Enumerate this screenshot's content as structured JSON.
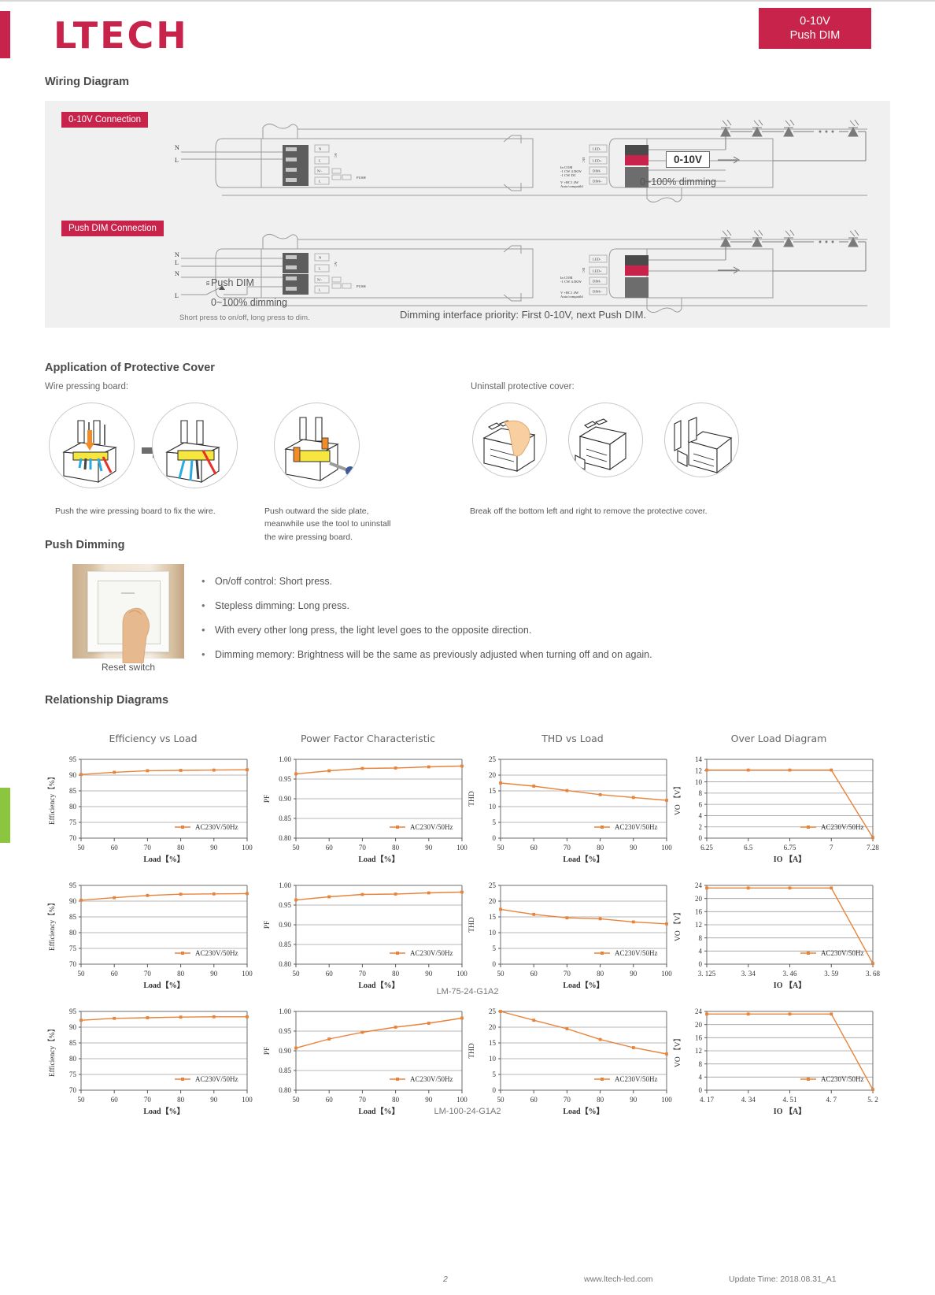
{
  "header": {
    "logo": "LTECH",
    "badge_line1": "0-10V",
    "badge_line2": "Push DIM",
    "brand_color": "#c8234a"
  },
  "sections": {
    "wiring": "Wiring Diagram",
    "cover": "Application of Protective Cover",
    "push": "Push Dimming",
    "relationship": "Relationship Diagrams"
  },
  "wiring": {
    "tag1": "0-10V Connection",
    "tag2": "Push DIM Connection",
    "n_label": "N",
    "l_label": "L",
    "push_dim_label": "Push DIM",
    "dimming_range_1": "0~100% dimming",
    "dimming_range_2": "0~100% dimming",
    "zero_ten_box": "0-10V",
    "short_press_note": "Short press to on/off, long press to dim.",
    "priority_note": "Dimming interface priority: First 0-10V, next Push DIM.",
    "terminal_labels": [
      "N",
      "L",
      "N",
      "L"
    ],
    "out_labels": [
      "LED-",
      "LED+",
      "DIM-",
      "DIM+"
    ],
    "side_ac": "AC",
    "side_dc": "DC"
  },
  "cover": {
    "sub_left": "Wire pressing board:",
    "sub_right": "Uninstall protective cover:",
    "cap1": "Push the wire pressing board to fix the wire.",
    "cap2": "Push outward the side plate,\nmeanwhile use the tool to uninstall\nthe wire pressing board.",
    "cap3": "Break off the bottom left and right to remove the protective cover."
  },
  "push_dimming": {
    "image_caption": "Reset switch",
    "bullets": [
      "On/off control: Short press.",
      "Stepless dimming: Long press.",
      "With every other long press, the light level goes to the opposite direction.",
      "Dimming memory: Brightness will be the same as previously adjusted when turning off and on again."
    ]
  },
  "models": {
    "row2": "LM-75-24-G1A2",
    "row3": "LM-100-24-G1A2"
  },
  "footer": {
    "page_number": "2",
    "website": "www.ltech-led.com",
    "update": "Update Time: 2018.08.31_A1"
  },
  "chart_data": [
    {
      "type": "line",
      "row": 1,
      "col": 1,
      "title": "Efficiency vs Load",
      "xlabel": "Load【%】",
      "ylabel": "Efficiency【%】",
      "legend": "AC230V/50Hz",
      "legend_position": "bottom-right",
      "grid": true,
      "color": "#e8833a",
      "xlim": [
        50,
        100
      ],
      "ylim": [
        70,
        95
      ],
      "xticks": [
        50,
        60,
        70,
        80,
        90,
        100
      ],
      "yticks": [
        70,
        75,
        80,
        85,
        90,
        95
      ],
      "x": [
        50,
        60,
        70,
        80,
        90,
        100
      ],
      "values": [
        90.2,
        90.9,
        91.4,
        91.5,
        91.6,
        91.7
      ]
    },
    {
      "type": "line",
      "row": 1,
      "col": 2,
      "title": "Power Factor Characteristic",
      "xlabel": "Load【%】",
      "ylabel": "PF",
      "legend": "AC230V/50Hz",
      "legend_position": "bottom-right",
      "grid": true,
      "color": "#e8833a",
      "xlim": [
        50,
        100
      ],
      "ylim": [
        0.8,
        1.0
      ],
      "xticks": [
        50,
        60,
        70,
        80,
        90,
        100
      ],
      "yticks": [
        "0.80",
        "0.85",
        "0.90",
        "0.95",
        "1.00"
      ],
      "x": [
        50,
        60,
        70,
        80,
        90,
        100
      ],
      "values": [
        0.963,
        0.971,
        0.977,
        0.978,
        0.981,
        0.983
      ]
    },
    {
      "type": "line",
      "row": 1,
      "col": 3,
      "title": "THD vs Load",
      "xlabel": "Load【%】",
      "ylabel": "THD",
      "legend": "AC230V/50Hz",
      "legend_position": "bottom-right",
      "grid": true,
      "color": "#e8833a",
      "xlim": [
        50,
        100
      ],
      "ylim": [
        0,
        25
      ],
      "xticks": [
        50,
        60,
        70,
        80,
        90,
        100
      ],
      "yticks": [
        0,
        5,
        10,
        15,
        20,
        25
      ],
      "x": [
        50,
        60,
        70,
        80,
        90,
        100
      ],
      "values": [
        17.5,
        16.5,
        15.1,
        13.8,
        12.9,
        12.0
      ]
    },
    {
      "type": "line",
      "row": 1,
      "col": 4,
      "title": "Over Load Diagram",
      "xlabel": "IO 【A】",
      "ylabel": "VO 【V】",
      "legend": "AC230V/50Hz",
      "legend_position": "bottom-right",
      "grid": true,
      "color": "#e8833a",
      "xlim": [
        6.25,
        7.28
      ],
      "ylim": [
        0,
        14
      ],
      "xticks": [
        "6.25",
        "6.5",
        "6.75",
        "7",
        "7.28"
      ],
      "yticks": [
        0,
        2,
        4,
        6,
        8,
        10,
        12,
        14
      ],
      "x": [
        "6.25",
        "6.5",
        "6.75",
        "7",
        "7.28"
      ],
      "values": [
        12.1,
        12.1,
        12.1,
        12.1,
        0.1
      ]
    },
    {
      "type": "line",
      "row": 2,
      "col": 1,
      "title": "",
      "xlabel": "Load【%】",
      "ylabel": "Efficiency【%】",
      "legend": "AC230V/50Hz",
      "legend_position": "bottom-right",
      "grid": true,
      "color": "#e8833a",
      "xlim": [
        50,
        100
      ],
      "ylim": [
        70,
        95
      ],
      "xticks": [
        50,
        60,
        70,
        80,
        90,
        100
      ],
      "yticks": [
        70,
        75,
        80,
        85,
        90,
        95
      ],
      "x": [
        50,
        60,
        70,
        80,
        90,
        100
      ],
      "values": [
        90.3,
        91.1,
        91.8,
        92.2,
        92.3,
        92.4
      ]
    },
    {
      "type": "line",
      "row": 2,
      "col": 2,
      "title": "",
      "xlabel": "Load【%】",
      "ylabel": "PF",
      "legend": "AC230V/50Hz",
      "legend_position": "bottom-right",
      "grid": true,
      "color": "#e8833a",
      "xlim": [
        50,
        100
      ],
      "ylim": [
        0.8,
        1.0
      ],
      "xticks": [
        50,
        60,
        70,
        80,
        90,
        100
      ],
      "yticks": [
        "0.80",
        "0.85",
        "0.90",
        "0.95",
        "1.00"
      ],
      "x": [
        50,
        60,
        70,
        80,
        90,
        100
      ],
      "values": [
        0.963,
        0.971,
        0.977,
        0.978,
        0.981,
        0.983
      ]
    },
    {
      "type": "line",
      "row": 2,
      "col": 3,
      "title": "",
      "xlabel": "Load【%】",
      "ylabel": "THD",
      "legend": "AC230V/50Hz",
      "legend_position": "bottom-right",
      "grid": true,
      "color": "#e8833a",
      "xlim": [
        50,
        100
      ],
      "ylim": [
        0,
        25
      ],
      "xticks": [
        50,
        60,
        70,
        80,
        90,
        100
      ],
      "yticks": [
        0,
        5,
        10,
        15,
        20,
        25
      ],
      "x": [
        50,
        60,
        70,
        80,
        90,
        100
      ],
      "values": [
        17.4,
        15.8,
        14.7,
        14.4,
        13.4,
        12.8
      ]
    },
    {
      "type": "line",
      "row": 2,
      "col": 4,
      "title": "",
      "xlabel": "IO 【A】",
      "ylabel": "VO 【V】",
      "legend": "AC230V/50Hz",
      "legend_position": "bottom-right",
      "grid": true,
      "color": "#e8833a",
      "xlim": [
        3.125,
        3.68
      ],
      "ylim": [
        0,
        24
      ],
      "xticks": [
        "3. 125",
        "3. 34",
        "3. 46",
        "3. 59",
        "3. 68"
      ],
      "yticks": [
        0,
        4,
        8,
        12,
        16,
        20,
        24
      ],
      "x": [
        "3. 125",
        "3. 34",
        "3. 46",
        "3. 59",
        "3. 68"
      ],
      "values": [
        23.2,
        23.2,
        23.2,
        23.2,
        0.2
      ]
    },
    {
      "type": "line",
      "row": 3,
      "col": 1,
      "title": "",
      "xlabel": "Load【%】",
      "ylabel": "Efficiency【%】",
      "legend": "AC230V/50Hz",
      "legend_position": "bottom-right",
      "grid": true,
      "color": "#e8833a",
      "xlim": [
        50,
        100
      ],
      "ylim": [
        70,
        95
      ],
      "xticks": [
        50,
        60,
        70,
        80,
        90,
        100
      ],
      "yticks": [
        70,
        75,
        80,
        85,
        90,
        95
      ],
      "x": [
        50,
        60,
        70,
        80,
        90,
        100
      ],
      "values": [
        92.2,
        92.8,
        93.0,
        93.2,
        93.3,
        93.3
      ]
    },
    {
      "type": "line",
      "row": 3,
      "col": 2,
      "title": "",
      "xlabel": "Load【%】",
      "ylabel": "PF",
      "legend": "AC230V/50Hz",
      "legend_position": "bottom-right",
      "grid": true,
      "color": "#e8833a",
      "xlim": [
        50,
        100
      ],
      "ylim": [
        0.8,
        1.0
      ],
      "xticks": [
        50,
        60,
        70,
        80,
        90,
        100
      ],
      "yticks": [
        "0.80",
        "0.85",
        "0.90",
        "0.95",
        "1.00"
      ],
      "x": [
        50,
        60,
        70,
        80,
        90,
        100
      ],
      "values": [
        0.907,
        0.93,
        0.947,
        0.96,
        0.97,
        0.983
      ]
    },
    {
      "type": "line",
      "row": 3,
      "col": 3,
      "title": "",
      "xlabel": "Load【%】",
      "ylabel": "THD",
      "legend": "AC230V/50Hz",
      "legend_position": "bottom-right",
      "grid": true,
      "color": "#e8833a",
      "xlim": [
        50,
        100
      ],
      "ylim": [
        0,
        25
      ],
      "xticks": [
        50,
        60,
        70,
        80,
        90,
        100
      ],
      "yticks": [
        0,
        5,
        10,
        15,
        20,
        25
      ],
      "x": [
        50,
        60,
        70,
        80,
        90,
        100
      ],
      "values": [
        25.0,
        22.2,
        19.5,
        16.1,
        13.5,
        11.5
      ]
    },
    {
      "type": "line",
      "row": 3,
      "col": 4,
      "title": "",
      "xlabel": "IO 【A】",
      "ylabel": "VO 【V】",
      "legend": "AC230V/50Hz",
      "legend_position": "bottom-right",
      "grid": true,
      "color": "#e8833a",
      "xlim": [
        4.17,
        5.2
      ],
      "ylim": [
        0,
        24
      ],
      "xticks": [
        "4. 17",
        "4. 34",
        "4. 51",
        "4. 7",
        "5. 2"
      ],
      "yticks": [
        0,
        4,
        8,
        12,
        16,
        20,
        24
      ],
      "x": [
        "4. 17",
        "4. 34",
        "4. 51",
        "4. 7",
        "5. 2"
      ],
      "values": [
        23.2,
        23.2,
        23.2,
        23.2,
        0.2
      ]
    }
  ]
}
